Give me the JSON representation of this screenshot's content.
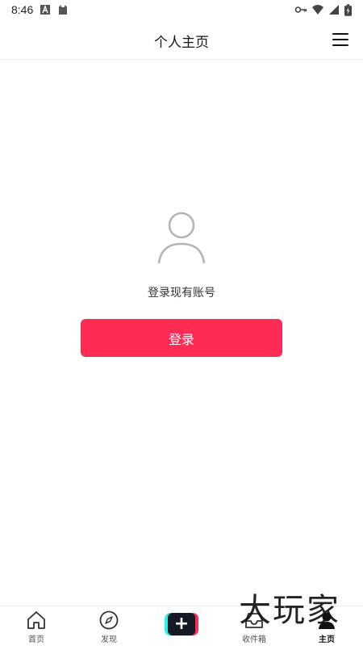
{
  "status_bar": {
    "time": "8:46",
    "icons": [
      "notification-a-icon",
      "cat-icon",
      "key-icon",
      "wifi-icon",
      "signal-icon",
      "battery-icon"
    ]
  },
  "header": {
    "title": "个人主页",
    "menu_icon": "menu-icon"
  },
  "main": {
    "avatar_icon": "user-avatar-icon",
    "prompt": "登录现有账号",
    "login_button": "登录",
    "login_button_color": "#fe2c55"
  },
  "bottom_nav": {
    "items": [
      {
        "label": "首页",
        "icon": "home-icon",
        "active": false
      },
      {
        "label": "发现",
        "icon": "compass-icon",
        "active": false
      },
      {
        "label": "",
        "icon": "plus-icon",
        "active": false
      },
      {
        "label": "收件箱",
        "icon": "inbox-icon",
        "active": false
      },
      {
        "label": "主页",
        "icon": "profile-icon",
        "active": true
      }
    ]
  },
  "watermark": "大玩家"
}
